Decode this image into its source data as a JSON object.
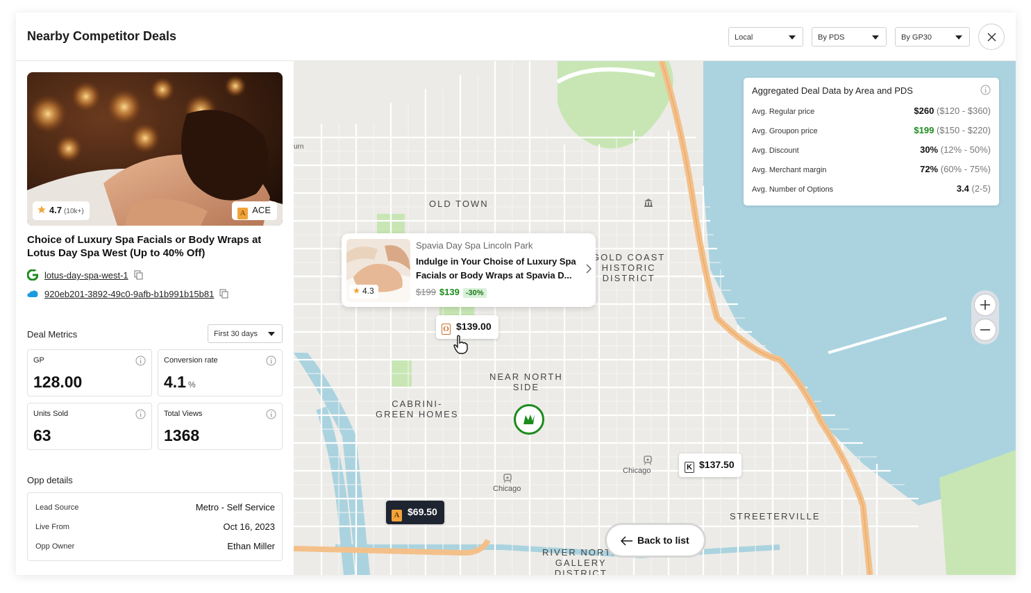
{
  "header": {
    "title": "Nearby Competitor Deals",
    "filters": [
      {
        "label": "Local"
      },
      {
        "label": "By PDS"
      },
      {
        "label": "By GP30"
      }
    ]
  },
  "deal": {
    "rating": "4.7",
    "rating_count": "(10k+)",
    "tier_badge": "ACE",
    "tier_logo_letter": "A",
    "title": "Choice of Luxury Spa Facials or Body Wraps at Lotus Day Spa West (Up to 40% Off)",
    "google_link": "lotus-day-spa-west-1",
    "salesforce_id": "920eb201-3892-49c0-9afb-b1b991b15b81"
  },
  "metrics": {
    "section_label": "Deal Metrics",
    "period": "First 30 days",
    "items": [
      {
        "label": "GP",
        "value": "128.00",
        "unit": ""
      },
      {
        "label": "Conversion rate",
        "value": "4.1",
        "unit": "%"
      },
      {
        "label": "Units Sold",
        "value": "63",
        "unit": ""
      },
      {
        "label": "Total Views",
        "value": "1368",
        "unit": ""
      }
    ]
  },
  "opp": {
    "section_label": "Opp details",
    "rows": [
      {
        "key": "Lead Source",
        "value": "Metro - Self Service"
      },
      {
        "key": "Live From",
        "value": "Oct 16, 2023"
      },
      {
        "key": "Opp Owner",
        "value": "Ethan Miller"
      }
    ]
  },
  "aggregate": {
    "title": "Aggregated Deal Data by Area and PDS",
    "rows": [
      {
        "key": "Avg. Regular price",
        "value": "$260",
        "range": "($120 - $360)",
        "green": false
      },
      {
        "key": "Avg. Groupon price",
        "value": "$199",
        "range": "($150 - $220)",
        "green": true
      },
      {
        "key": "Avg. Discount",
        "value": "30%",
        "range": "(12% - 50%)",
        "green": false
      },
      {
        "key": "Avg. Merchant margin",
        "value": "72%",
        "range": "(60% - 75%)",
        "green": false
      },
      {
        "key": "Avg. Number of Options",
        "value": "3.4",
        "range": "(2-5)",
        "green": false
      }
    ]
  },
  "popup": {
    "merchant": "Spavia Day Spa Lincoln Park",
    "title": "Indulge in Your Choise of Luxury Spa Facials or Body Wraps at Spavia D...",
    "rating": "4.3",
    "old_price": "$199",
    "new_price": "$139",
    "discount": "-30%"
  },
  "pins": [
    {
      "logo": "O",
      "price": "$139.00"
    },
    {
      "logo": "K",
      "price": "$137.50"
    },
    {
      "logo": "A",
      "price": "$69.50"
    }
  ],
  "map_labels": {
    "old_town": "OLD TOWN",
    "gold_coast_1": "GOLD COAST",
    "gold_coast_2": "HISTORIC",
    "gold_coast_3": "DISTRICT",
    "near_north_1": "NEAR NORTH",
    "near_north_2": "SIDE",
    "cabrini_1": "CABRINI-",
    "cabrini_2": "GREEN HOMES",
    "streeterville": "STREETERVILLE",
    "river_north_1": "RIVER NORTH",
    "river_north_2": "GALLERY",
    "river_north_3": "DISTRICT",
    "chicago_1": "Chicago",
    "chicago_2": "Chicago",
    "urn": "urn"
  },
  "back_button": "Back to list",
  "colors": {
    "accent_green": "#1c8b1c",
    "water": "#aad3df",
    "highway": "#f4c08a",
    "park": "#c8e6b4"
  }
}
